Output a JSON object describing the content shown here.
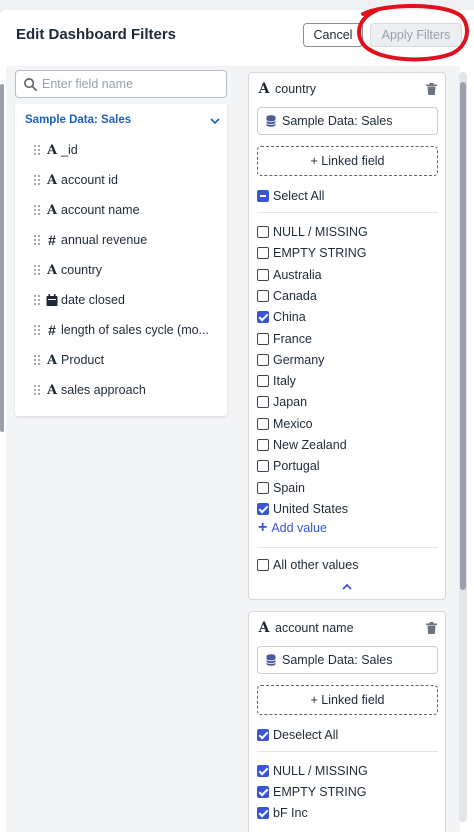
{
  "header": {
    "title": "Edit Dashboard Filters",
    "cancel_label": "Cancel",
    "apply_label": "Apply Filters"
  },
  "search": {
    "placeholder": "Enter field name",
    "value": ""
  },
  "datasource": {
    "name": "Sample Data: Sales",
    "fields": [
      {
        "type": "text",
        "name": "_id"
      },
      {
        "type": "text",
        "name": "account id"
      },
      {
        "type": "text",
        "name": "account name"
      },
      {
        "type": "number",
        "name": "annual revenue"
      },
      {
        "type": "text",
        "name": "country"
      },
      {
        "type": "date",
        "name": "date closed"
      },
      {
        "type": "number",
        "name": "length of sales cycle (mo..."
      },
      {
        "type": "text",
        "name": "Product"
      },
      {
        "type": "text",
        "name": "sales approach"
      }
    ]
  },
  "type_glyphs": {
    "text": "A",
    "number": "#"
  },
  "filters": [
    {
      "field": "country",
      "datasource": "Sample Data: Sales",
      "linked_label": "+ Linked field",
      "select_all_label": "Select All",
      "options": [
        {
          "label": "NULL / MISSING",
          "checked": false
        },
        {
          "label": "EMPTY STRING",
          "checked": false
        },
        {
          "label": "Australia",
          "checked": false
        },
        {
          "label": "Canada",
          "checked": false
        },
        {
          "label": "China",
          "checked": true
        },
        {
          "label": "France",
          "checked": false
        },
        {
          "label": "Germany",
          "checked": false
        },
        {
          "label": "Italy",
          "checked": false
        },
        {
          "label": "Japan",
          "checked": false
        },
        {
          "label": "Mexico",
          "checked": false
        },
        {
          "label": "New Zealand",
          "checked": false
        },
        {
          "label": "Portugal",
          "checked": false
        },
        {
          "label": "Spain",
          "checked": false
        },
        {
          "label": "United States",
          "checked": true
        }
      ],
      "add_value_label": "Add value",
      "other_values_label": "All other values"
    },
    {
      "field": "account name",
      "datasource": "Sample Data: Sales",
      "linked_label": "+ Linked field",
      "deselect_all_label": "Deselect All",
      "options": [
        {
          "label": "NULL / MISSING",
          "checked": true
        },
        {
          "label": "EMPTY STRING",
          "checked": true
        },
        {
          "label": "bF Inc",
          "checked": true
        }
      ]
    }
  ],
  "colors": {
    "accent": "#3b55d9",
    "link_blue": "#1f5fbf",
    "annotation_red": "#e0101c"
  }
}
